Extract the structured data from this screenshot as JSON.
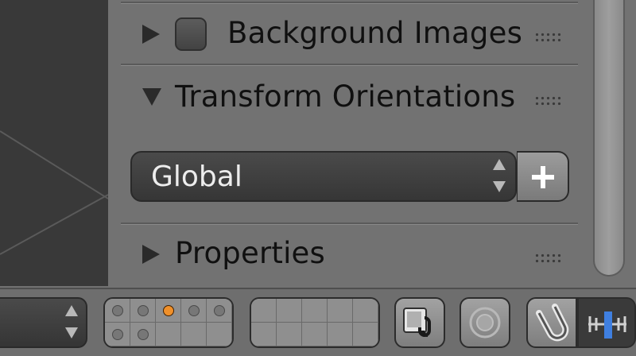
{
  "panel": {
    "sections": {
      "background_images": "Background Images",
      "transform_orientations": "Transform Orientations",
      "properties": "Properties"
    },
    "orientation_select": {
      "value": "Global"
    }
  },
  "bottombar": {
    "layers": {
      "active_layer_index": 2,
      "layer_count": 20
    }
  },
  "icons": {
    "plus": "plus-icon",
    "manipulator": "manipulator-icon",
    "proportional_edit": "proportional-edit-icon",
    "snap": "snap-magnet-icon",
    "snap_element": "snap-element-icon"
  },
  "colors": {
    "active_layer": "#f0902a",
    "panel_bg": "#727272",
    "viewport_bg": "#393939"
  }
}
